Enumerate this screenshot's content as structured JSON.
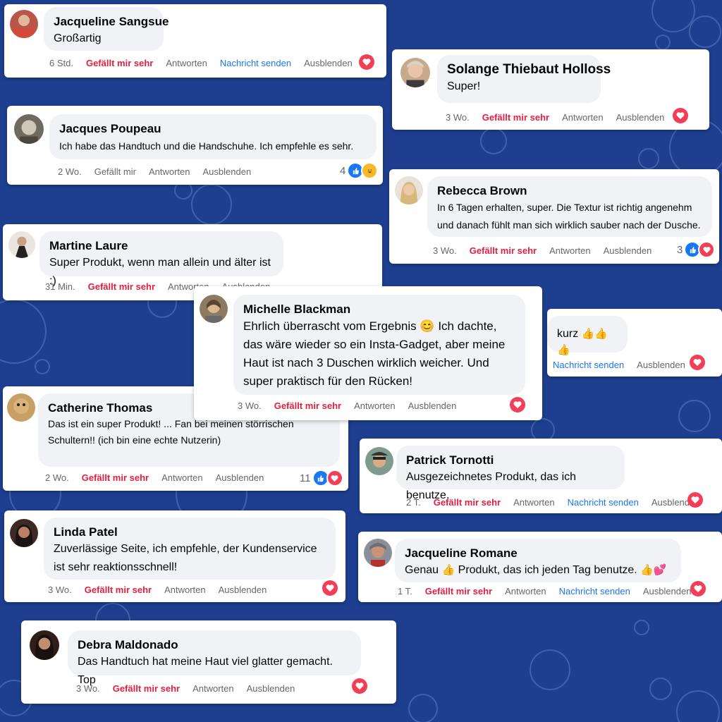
{
  "colors": {
    "background": "#1e3f8f",
    "like_red": "#e41e3f",
    "link_blue": "#1877f2",
    "heart": "#f33e58"
  },
  "labels": {
    "like": "Gefällt mir sehr",
    "like_plain": "Gefällt mir",
    "reply": "Antworten",
    "message": "Nachricht senden",
    "hide": "Ausblenden"
  },
  "comments": [
    {
      "name": "Jacqueline Sangsue",
      "text": "Großartig",
      "time": "6 Std."
    },
    {
      "name": "Solange Thiebaut Holloss",
      "text": "Super!",
      "time": "3 Wo."
    },
    {
      "name": "Jacques Poupeau",
      "text": "Ich habe das Handtuch und die Handschuhe. Ich empfehle es sehr.",
      "time": "2 Wo.",
      "reaction_count": "4"
    },
    {
      "name": "Rebecca Brown",
      "text": "In 6 Tagen erhalten, super. Die Textur ist richtig angenehm und danach fühlt man sich wirklich sauber nach der Dusche.",
      "time": "3 Wo.",
      "reaction_count": "3"
    },
    {
      "name": "Martine Laure",
      "text": "Super Produkt, wenn man allein und älter ist :)",
      "time": "31 Min."
    },
    {
      "name": "Michelle Blackman",
      "text_parts": [
        "Ehrlich überrascht vom Ergebnis",
        "😊",
        "Ich dachte, das wäre wieder so ein Insta-Gadget, aber meine Haut ist nach 3 Duschen wirklich weicher. Und super praktisch für den Rücken!"
      ],
      "time": "3 Wo."
    },
    {
      "text": "kurz",
      "emoji": "👍👍👍"
    },
    {
      "name": "Catherine Thomas",
      "text": "Das ist ein super Produkt! ... Fan bei meinen störrischen Schultern!! (ich bin eine echte Nutzerin)",
      "time": "2 Wo.",
      "reaction_count": "11"
    },
    {
      "name": "Patrick Tornotti",
      "text": "Ausgezeichnetes Produkt, das ich benutze.",
      "time": "2 T."
    },
    {
      "name": "Linda Patel",
      "text": "Zuverlässige Seite, ich empfehle, der Kundenservice ist sehr reaktionsschnell!",
      "time": "3 Wo."
    },
    {
      "name": "Jacqueline Romane",
      "text_parts": [
        "Genau",
        "👍",
        "Produkt, das ich jeden Tag benutze.",
        "👍💕"
      ],
      "time": "1 T."
    },
    {
      "name": "Debra Maldonado",
      "text": "Das Handtuch hat meine Haut viel glatter gemacht. Top",
      "time": "3 Wo."
    }
  ]
}
